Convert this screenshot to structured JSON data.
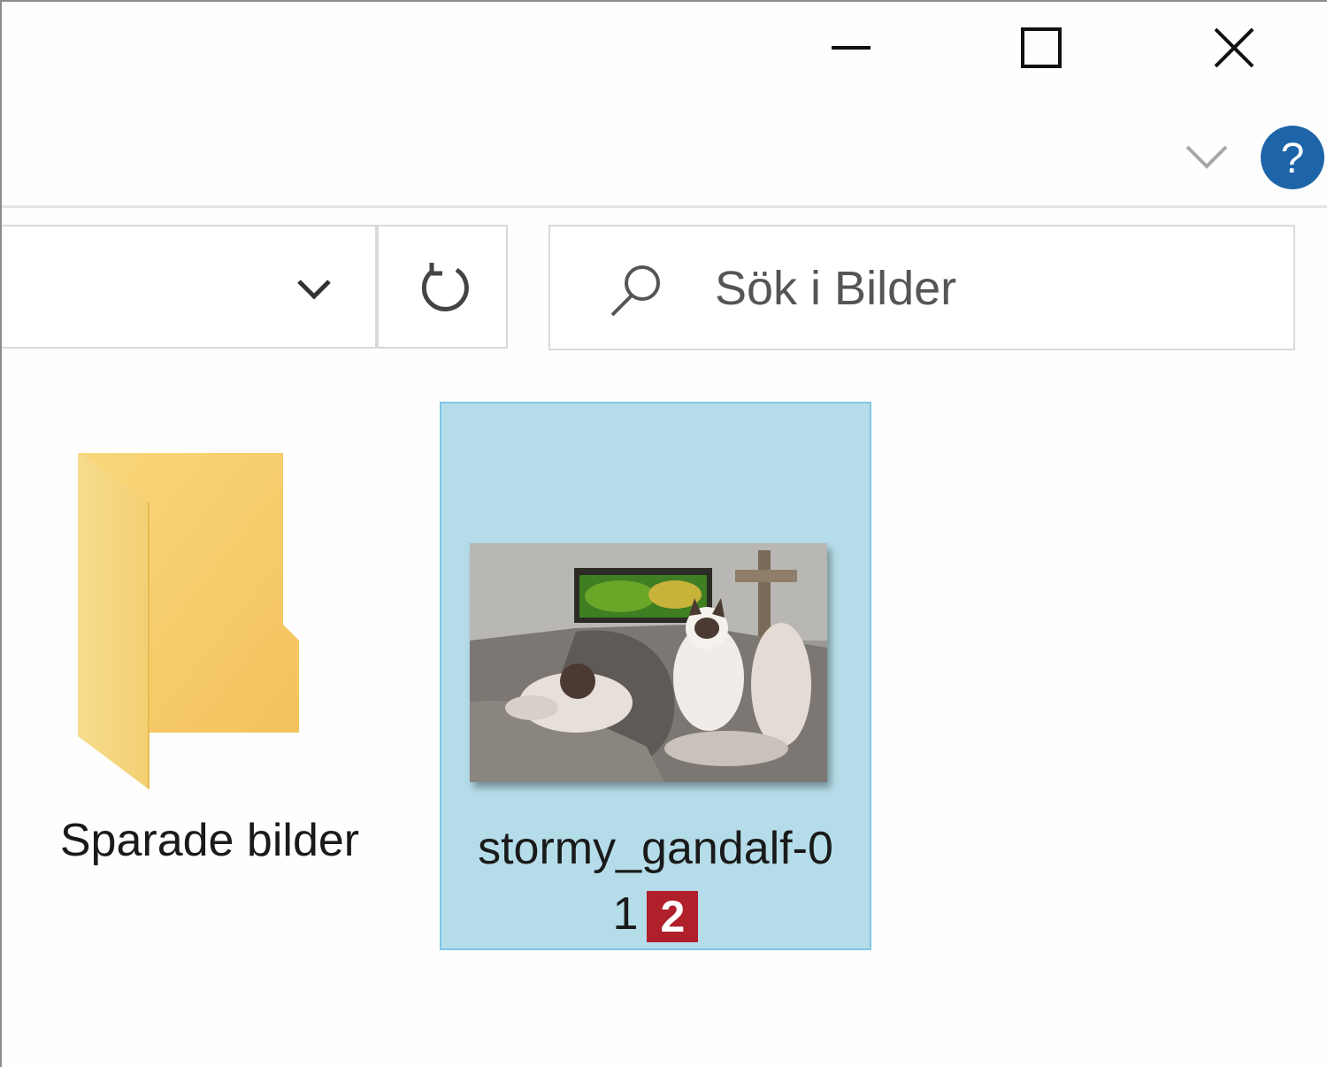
{
  "window": {
    "caption_buttons": [
      "minimize",
      "maximize",
      "close"
    ]
  },
  "ribbon": {
    "expand_icon": "chevron-down-icon",
    "help_symbol": "?"
  },
  "address_bar": {
    "value": "",
    "dropdown_icon": "chevron-down-icon"
  },
  "refresh": {
    "icon": "refresh-icon"
  },
  "search": {
    "placeholder": "Sök i Bilder",
    "icon": "search-icon"
  },
  "items": [
    {
      "type": "folder",
      "name": "Sparade bilder",
      "icon": "folder-icon",
      "selected": false
    },
    {
      "type": "image",
      "name_line1": "stormy_gandalf-0",
      "name_line2": "1",
      "icon": "image-thumbnail",
      "selected": true
    }
  ],
  "callout": {
    "number": "2",
    "color": "#b0202a"
  },
  "colors": {
    "selection_fill": "#b5dde9",
    "selection_border": "#7fc6e4",
    "help_blue": "#1e64a8",
    "folder_yellow": "#f7cf6a"
  }
}
